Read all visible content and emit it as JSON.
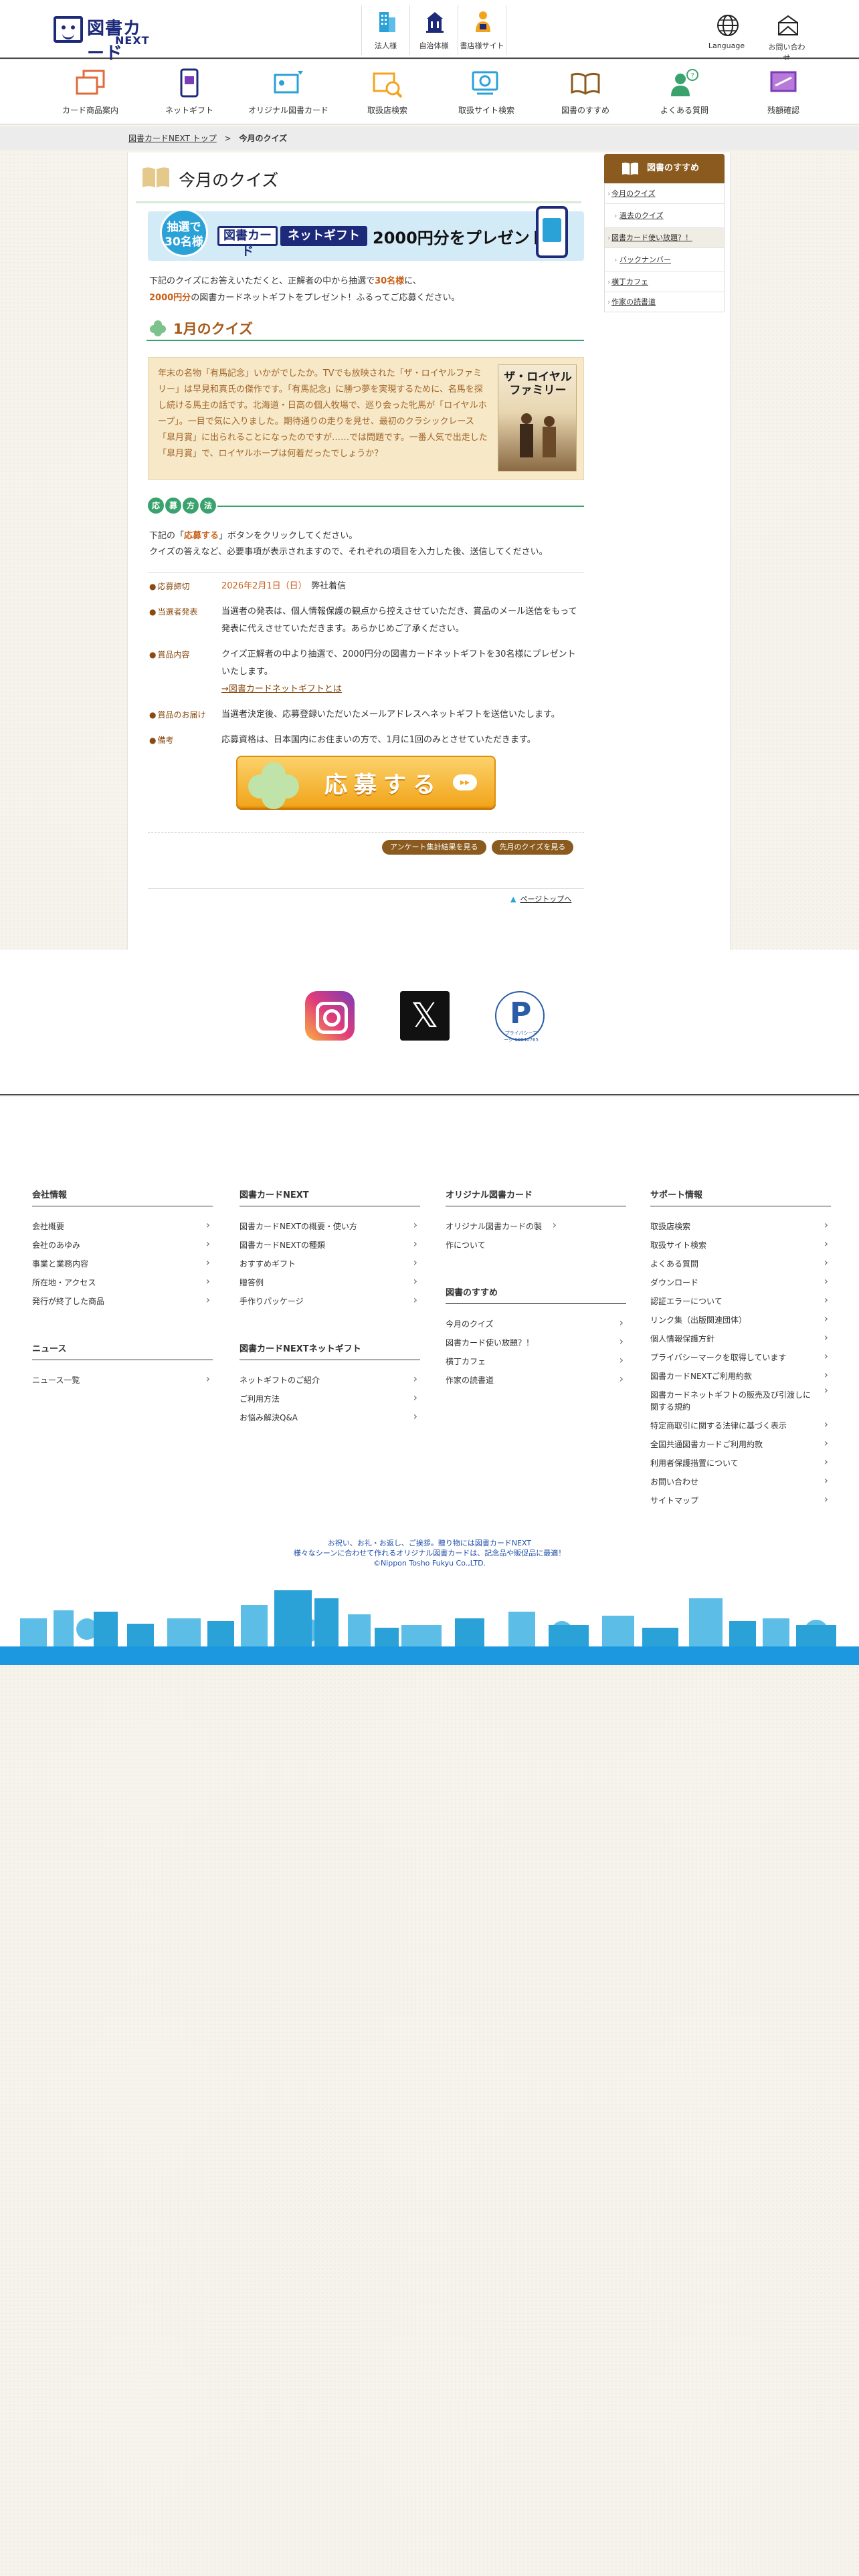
{
  "header": {
    "logo_text": "図書カード",
    "logo_sub": "NEXT",
    "links": [
      {
        "label": "法人様",
        "icon": "building-icon"
      },
      {
        "label": "自治体様",
        "icon": "city-hall-icon"
      },
      {
        "label": "書店様サイト",
        "icon": "bookstore-person-icon"
      }
    ],
    "language_label": "Language",
    "contact_label": "お問い合わせ"
  },
  "gnav": [
    {
      "label": "カード商品案内",
      "icon": "cards-icon"
    },
    {
      "label": "ネットギフト",
      "icon": "phone-gift-icon"
    },
    {
      "label": "オリジナル図書カード",
      "icon": "original-card-icon"
    },
    {
      "label": "取扱店検索",
      "icon": "store-search-icon"
    },
    {
      "label": "取扱サイト検索",
      "icon": "site-search-icon"
    },
    {
      "label": "図書のすすめ",
      "icon": "open-book-icon"
    },
    {
      "label": "よくある質問",
      "icon": "faq-person-icon"
    },
    {
      "label": "残額確認",
      "icon": "balance-card-icon"
    }
  ],
  "breadcrumb": {
    "top": "図書カードNEXT トップ",
    "separator": ">",
    "current": "今月のクイズ"
  },
  "page": {
    "title": "今月のクイズ",
    "banner": {
      "badge_line1": "抽選で",
      "badge_line2": "30名様",
      "card_logo": "図書カード",
      "net_gift": "ネットギフト",
      "present": "2000円分をプレゼント!"
    },
    "intro_part1": "下記のクイズにお答えいただくと、正解者の中から抽選で",
    "intro_hl1": "30名様",
    "intro_part2": "に、",
    "intro_hl2": "2000円分",
    "intro_part3": "の図書カードネットギフトをプレゼント！ふるってご応募ください。",
    "quiz_heading": "1月のクイズ",
    "quiz_text": "年末の名物「有馬記念」いかがでしたか。TVでも放映された「ザ・ロイヤルファミリー」は早見和真氏の傑作です。「有馬記念」に勝つ夢を実現するために、名馬を探し続ける馬主の話です。北海道・日高の個人牧場で、巡り会った牝馬が「ロイヤルホープ」。一目で気に入りました。期待通りの走りを見せ、最初のクラシックレース「皐月賞」に出られることになったのですが……では問題です。一番人気で出走した「皐月賞」で、ロイヤルホープは何着だったでしょうか？",
    "book_title": "ザ・ロイヤルファミリー",
    "oubo_chars": [
      "応",
      "募",
      "方",
      "法"
    ],
    "howto_part1": "下記の「",
    "howto_btn": "応募する",
    "howto_part2": "」ボタンをクリックしてください。",
    "howto_line2": "クイズの答えなど、必要事項が表示されますので、それぞれの項目を入力した後、送信してください。",
    "info": [
      {
        "label": "応募締切",
        "date": "2026年2月1日（日）",
        "value": "弊社着信"
      },
      {
        "label": "当選者発表",
        "value": "当選者の発表は、個人情報保護の観点から控えさせていただき、賞品のメール送信をもって発表に代えさせていただきます。あらかじめご了承ください。"
      },
      {
        "label": "賞品内容",
        "value": "クイズ正解者の中より抽選で、2000円分の図書カードネットギフトを30名様にプレゼントいたします。",
        "link": "→図書カードネットギフトとは"
      },
      {
        "label": "賞品のお届け",
        "value": "当選者決定後、応募登録いただいたメールアドレスへネットギフトを送信いたします。"
      },
      {
        "label": "備考",
        "value": "応募資格は、日本国内にお住まいの方で、1月に1回のみとさせていただきます。"
      }
    ],
    "apply_label": "応募する",
    "apply_arrow": "▸▸",
    "pill_buttons": [
      "アンケート集計結果を見る",
      "先月のクイズを見る"
    ],
    "pagetop_arrow": "▲",
    "pagetop": "ページトップへ"
  },
  "side": {
    "heading": "図書のすすめ",
    "items": [
      {
        "label": "今月のクイズ"
      },
      {
        "label": "過去のクイズ",
        "sub": true
      },
      {
        "label": "図書カード使い放題？！",
        "highlight": true
      },
      {
        "label": "バックナンバー",
        "sub": true
      },
      {
        "label": "横丁カフェ"
      },
      {
        "label": "作家の読書道"
      }
    ]
  },
  "sns": {
    "x_glyph": "𝕏",
    "pmark_glyph": "P",
    "pmark_text": "プライバシーマーク 10840765"
  },
  "footer": {
    "columns": [
      {
        "groups": [
          {
            "title": "会社情報",
            "items": [
              "会社概要",
              "会社のあゆみ",
              "事業と業務内容",
              "所在地・アクセス",
              "発行が終了した商品"
            ]
          },
          {
            "title": "ニュース",
            "items": [
              "ニュース一覧"
            ]
          }
        ]
      },
      {
        "groups": [
          {
            "title": "図書カードNEXT",
            "items": [
              "図書カードNEXTの概要・使い方",
              "図書カードNEXTの種類",
              "おすすめギフト",
              "贈答例",
              "手作りパッケージ"
            ]
          },
          {
            "title": "図書カードNEXTネットギフト",
            "items": [
              "ネットギフトのご紹介",
              "ご利用方法",
              "お悩み解決Q&A"
            ]
          }
        ]
      },
      {
        "groups": [
          {
            "title": "オリジナル図書カード",
            "items": [
              "オリジナル図書カードの製作について"
            ]
          },
          {
            "title": "図書のすすめ",
            "items": [
              "今月のクイズ",
              "図書カード使い放題？！",
              "横丁カフェ",
              "作家の読書道"
            ]
          }
        ]
      },
      {
        "groups": [
          {
            "title": "サポート情報",
            "items": [
              "取扱店検索",
              "取扱サイト検索",
              "よくある質問",
              "ダウンロード",
              "認証エラーについて",
              "リンク集（出版関連団体）",
              "個人情報保護方針",
              "プライバシーマークを取得しています",
              "図書カードNEXTご利用約款",
              "図書カードネットギフトの販売及び引渡しに関する規約",
              "特定商取引に関する法律に基づく表示",
              "全国共通図書カードご利用約款",
              "利用者保護措置について",
              "お問い合わせ",
              "サイトマップ"
            ]
          }
        ]
      }
    ],
    "copyright_line1": "お祝い、お礼・お返し、ご挨拶。贈り物には図書カードNEXT",
    "copyright_line2": "様々なシーンに合わせて作れるオリジナル図書カードは、記念品や販促品に最適！",
    "copyright_line3": "©Nippon Tosho Fukyu Co.,LTD."
  },
  "colors": {
    "brand_navy": "#1d2a7a",
    "accent_brown": "#8a5a1e",
    "accent_orange": "#c8601a",
    "accent_green": "#3aa36d",
    "footer_city_blue": "#1b98e0"
  }
}
